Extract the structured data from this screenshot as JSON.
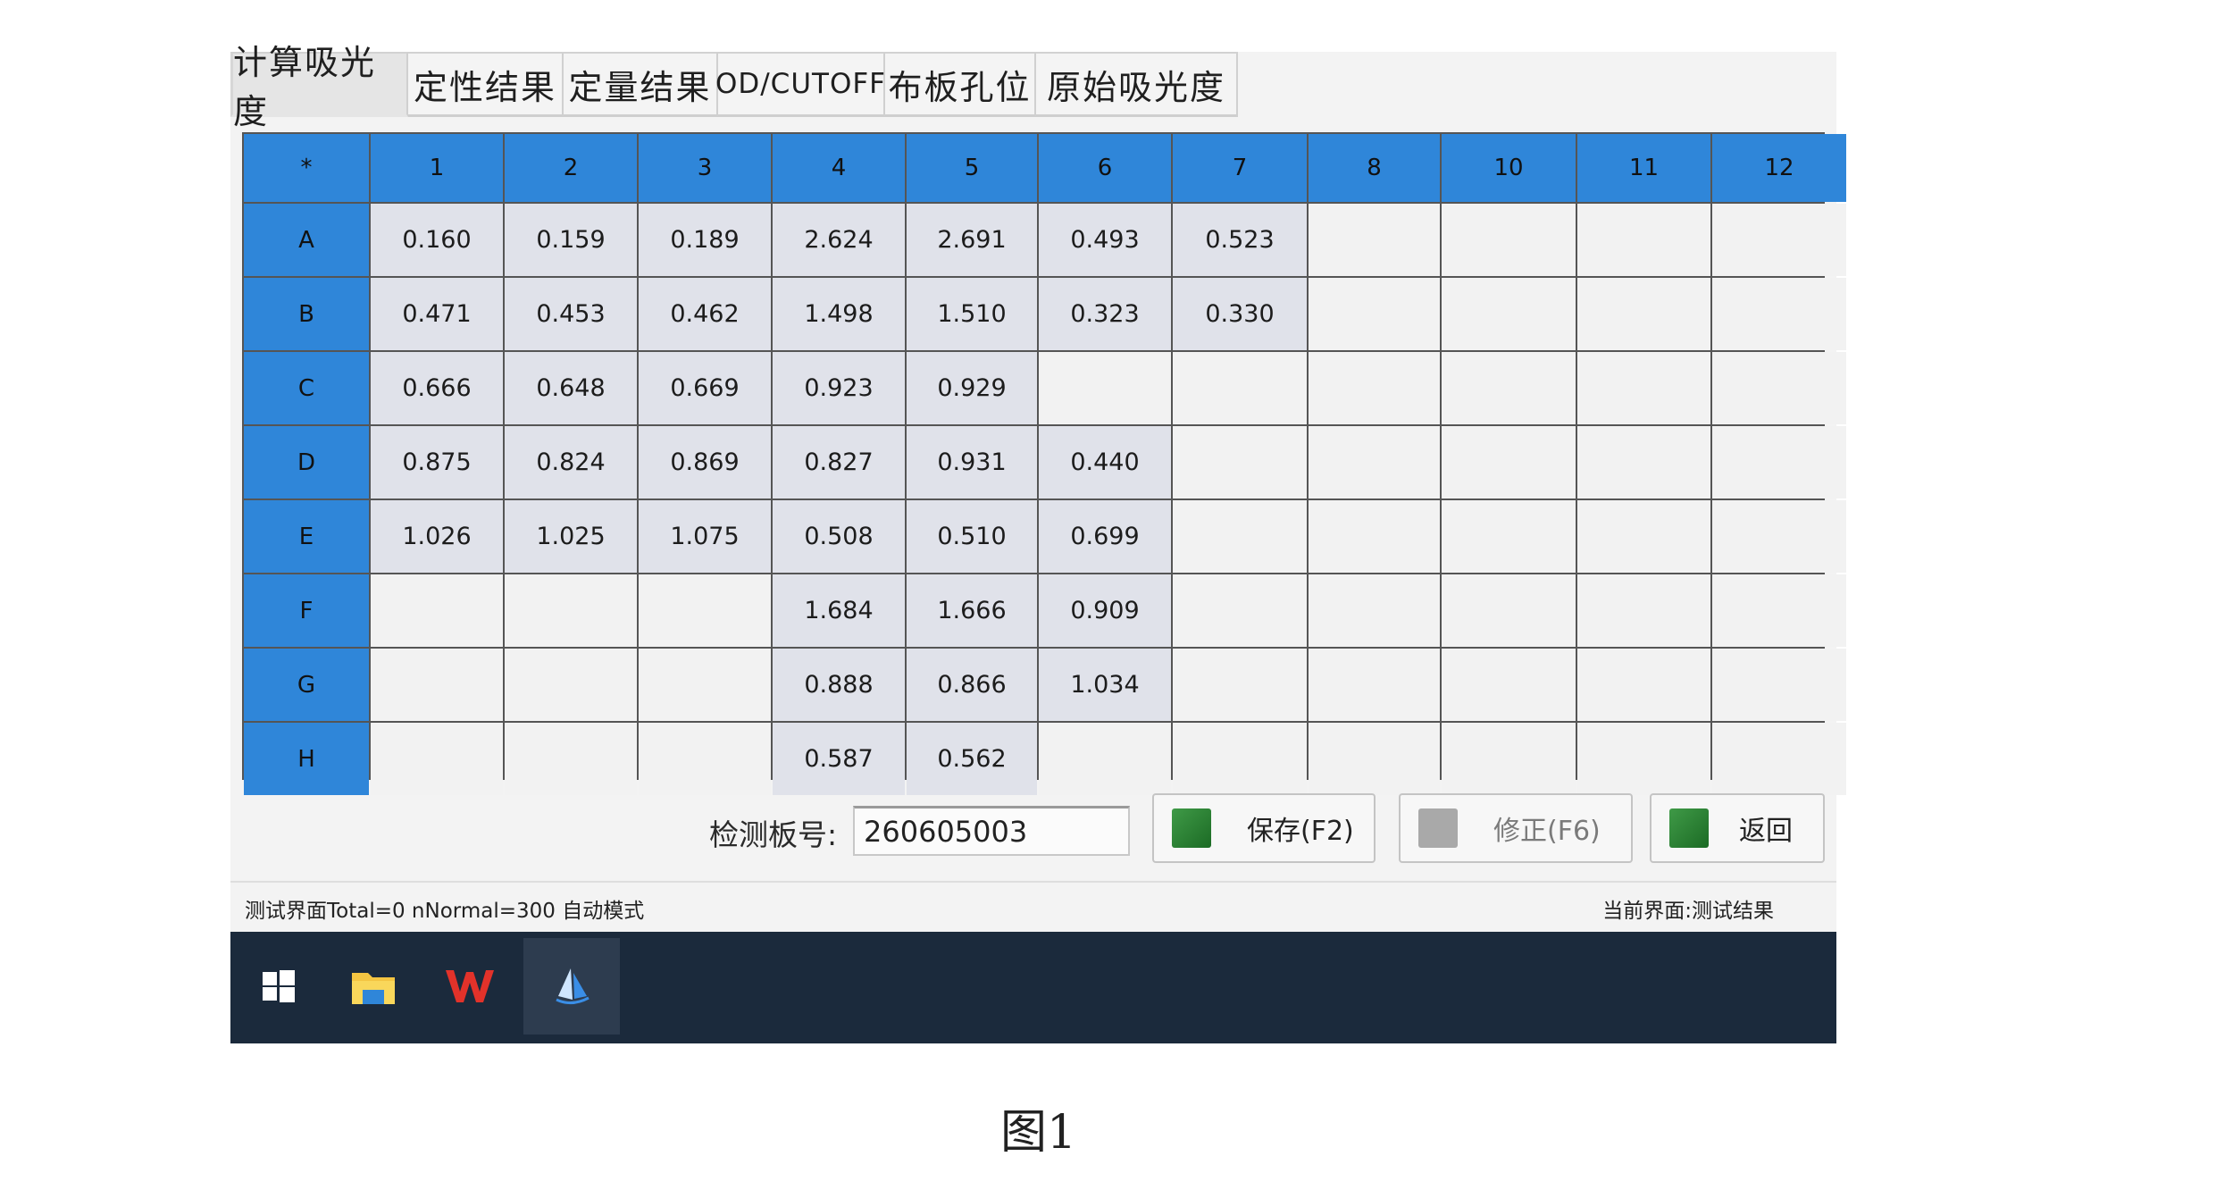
{
  "tabs": [
    {
      "label": "计算吸光度",
      "active": true
    },
    {
      "label": "定性结果",
      "active": false
    },
    {
      "label": "定量结果",
      "active": false
    },
    {
      "label": "OD/CUTOFF",
      "active": false
    },
    {
      "label": "布板孔位",
      "active": false
    },
    {
      "label": "原始吸光度",
      "active": false
    }
  ],
  "table": {
    "corner": "*",
    "columns": [
      "1",
      "2",
      "3",
      "4",
      "5",
      "6",
      "7",
      "8",
      "10",
      "11",
      "12"
    ],
    "rows": [
      {
        "label": "A",
        "values": [
          "0.160",
          "0.159",
          "0.189",
          "2.624",
          "2.691",
          "0.493",
          "0.523",
          "",
          "",
          "",
          ""
        ]
      },
      {
        "label": "B",
        "values": [
          "0.471",
          "0.453",
          "0.462",
          "1.498",
          "1.510",
          "0.323",
          "0.330",
          "",
          "",
          "",
          ""
        ]
      },
      {
        "label": "C",
        "values": [
          "0.666",
          "0.648",
          "0.669",
          "0.923",
          "0.929",
          "",
          "",
          "",
          "",
          "",
          ""
        ]
      },
      {
        "label": "D",
        "values": [
          "0.875",
          "0.824",
          "0.869",
          "0.827",
          "0.931",
          "0.440",
          "",
          "",
          "",
          "",
          ""
        ]
      },
      {
        "label": "E",
        "values": [
          "1.026",
          "1.025",
          "1.075",
          "0.508",
          "0.510",
          "0.699",
          "",
          "",
          "",
          "",
          ""
        ]
      },
      {
        "label": "F",
        "values": [
          "",
          "",
          "",
          "1.684",
          "1.666",
          "0.909",
          "",
          "",
          "",
          "",
          ""
        ]
      },
      {
        "label": "G",
        "values": [
          "",
          "",
          "",
          "0.888",
          "0.866",
          "1.034",
          "",
          "",
          "",
          "",
          ""
        ]
      },
      {
        "label": "H",
        "values": [
          "",
          "",
          "",
          "0.587",
          "0.562",
          "",
          "",
          "",
          "",
          "",
          ""
        ]
      }
    ]
  },
  "plate": {
    "label": "检测板号:",
    "value": "260605003"
  },
  "buttons": {
    "save": "保存(F2)",
    "fix": "修正(F6)",
    "back": "返回"
  },
  "status": {
    "left": "测试界面Total=0 nNormal=300 自动模式",
    "right": "当前界面:测试结果"
  },
  "taskbar": [
    "windows-start",
    "file-explorer",
    "wps-office",
    "app"
  ],
  "caption": "图1",
  "colors": {
    "header_blue": "#2f86d9",
    "value_cell": "#e0e2ea",
    "taskbar": "#1b2a3c"
  }
}
